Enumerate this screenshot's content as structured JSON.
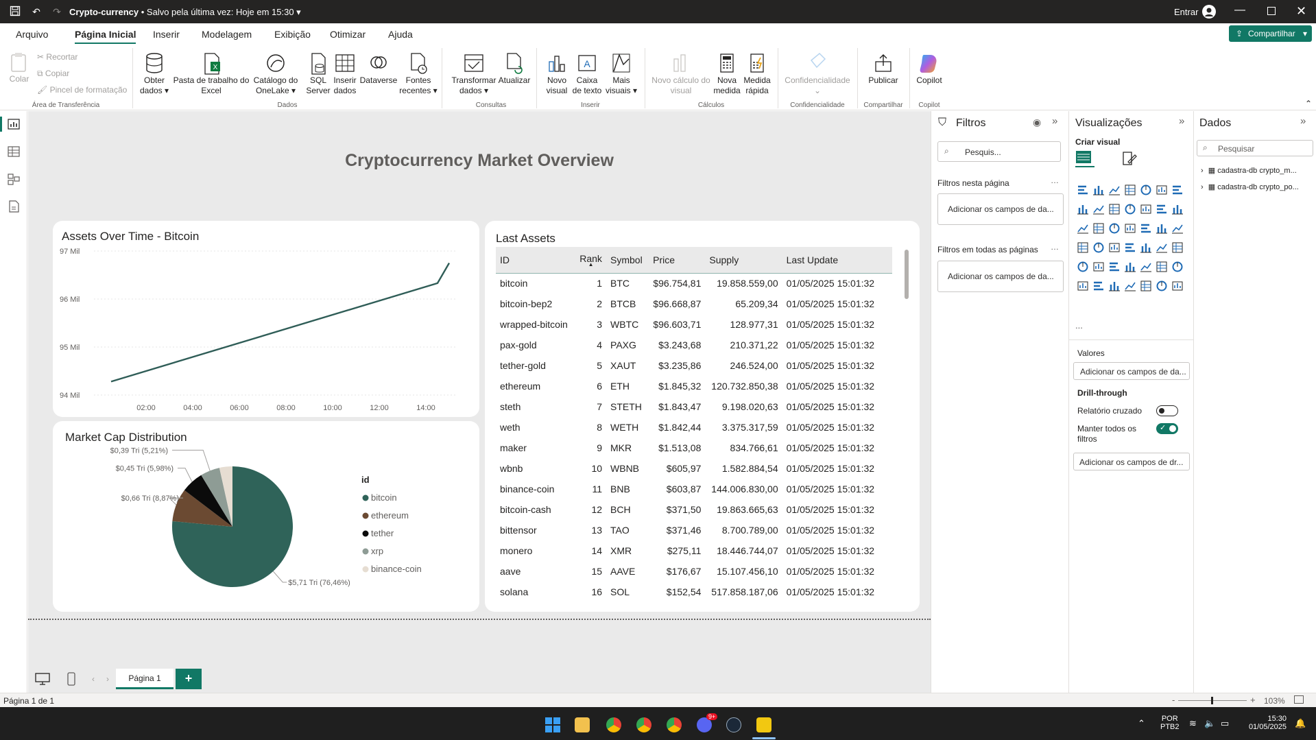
{
  "window": {
    "file_name": "Crypto-currency",
    "saved_status": "• Salvo pela última vez: Hoje em 15:30",
    "signin_label": "Entrar"
  },
  "menu": {
    "items": [
      "Arquivo",
      "Página Inicial",
      "Inserir",
      "Modelagem",
      "Exibição",
      "Otimizar",
      "Ajuda"
    ],
    "active": "Página Inicial",
    "share_label": "Compartilhar"
  },
  "ribbon": {
    "clipboard": {
      "paste": "Colar",
      "cut": "Recortar",
      "copy": "Copiar",
      "format_painter": "Pincel de formatação",
      "group": "Área de Transferência"
    },
    "data": {
      "get_data": "Obter dados",
      "excel": "Pasta de trabalho do Excel",
      "onelake": "Catálogo do OneLake",
      "sql": "SQL Server",
      "enter_data": "Inserir dados",
      "dataverse": "Dataverse",
      "recent": "Fontes recentes",
      "group": "Dados"
    },
    "queries": {
      "transform": "Transformar dados",
      "refresh": "Atualizar",
      "group": "Consultas"
    },
    "insert": {
      "new_visual": "Novo visual",
      "text_box": "Caixa de texto",
      "more_visuals": "Mais visuais",
      "group": "Inserir"
    },
    "calculations": {
      "visual_calc": "Novo cálculo do visual",
      "new_measure": "Nova medida",
      "quick_measure": "Medida rápida",
      "group": "Cálculos"
    },
    "sensitivity": {
      "label": "Confidencialidade",
      "group": "Confidencialidade"
    },
    "share": {
      "publish": "Publicar",
      "group": "Compartilhar"
    },
    "copilot": {
      "label": "Copilot",
      "group": "Copilot"
    }
  },
  "report": {
    "title": "Cryptocurrency Market Overview",
    "line_visual_title": "Assets Over Time - Bitcoin",
    "pie_visual_title": "Market Cap Distribution",
    "pie_legend_title": "id",
    "table_title": "Last Assets",
    "table": {
      "columns": [
        "ID",
        "Rank",
        "Symbol",
        "Price",
        "Supply",
        "Last Update"
      ],
      "rows": [
        [
          "bitcoin",
          "1",
          "BTC",
          "$96.754,81",
          "19.858.559,00",
          "01/05/2025 15:01:32"
        ],
        [
          "bitcoin-bep2",
          "2",
          "BTCB",
          "$96.668,87",
          "65.209,34",
          "01/05/2025 15:01:32"
        ],
        [
          "wrapped-bitcoin",
          "3",
          "WBTC",
          "$96.603,71",
          "128.977,31",
          "01/05/2025 15:01:32"
        ],
        [
          "pax-gold",
          "4",
          "PAXG",
          "$3.243,68",
          "210.371,22",
          "01/05/2025 15:01:32"
        ],
        [
          "tether-gold",
          "5",
          "XAUT",
          "$3.235,86",
          "246.524,00",
          "01/05/2025 15:01:32"
        ],
        [
          "ethereum",
          "6",
          "ETH",
          "$1.845,32",
          "120.732.850,38",
          "01/05/2025 15:01:32"
        ],
        [
          "steth",
          "7",
          "STETH",
          "$1.843,47",
          "9.198.020,63",
          "01/05/2025 15:01:32"
        ],
        [
          "weth",
          "8",
          "WETH",
          "$1.842,44",
          "3.375.317,59",
          "01/05/2025 15:01:32"
        ],
        [
          "maker",
          "9",
          "MKR",
          "$1.513,08",
          "834.766,61",
          "01/05/2025 15:01:32"
        ],
        [
          "wbnb",
          "10",
          "WBNB",
          "$605,97",
          "1.582.884,54",
          "01/05/2025 15:01:32"
        ],
        [
          "binance-coin",
          "11",
          "BNB",
          "$603,87",
          "144.006.830,00",
          "01/05/2025 15:01:32"
        ],
        [
          "bitcoin-cash",
          "12",
          "BCH",
          "$371,50",
          "19.863.665,63",
          "01/05/2025 15:01:32"
        ],
        [
          "bittensor",
          "13",
          "TAO",
          "$371,46",
          "8.700.789,00",
          "01/05/2025 15:01:32"
        ],
        [
          "monero",
          "14",
          "XMR",
          "$275,11",
          "18.446.744,07",
          "01/05/2025 15:01:32"
        ],
        [
          "aave",
          "15",
          "AAVE",
          "$176,67",
          "15.107.456,10",
          "01/05/2025 15:01:32"
        ],
        [
          "solana",
          "16",
          "SOL",
          "$152,54",
          "517.858.187,06",
          "01/05/2025 15:01:32"
        ]
      ]
    }
  },
  "chart_data": [
    {
      "type": "line",
      "title": "Assets Over Time - Bitcoin",
      "x": [
        "00:30",
        "14:30",
        "15:00"
      ],
      "x_ticks": [
        "02:00",
        "04:00",
        "06:00",
        "08:00",
        "10:00",
        "12:00",
        "14:00"
      ],
      "y_ticks": [
        "94 Mil",
        "95 Mil",
        "96 Mil",
        "97 Mil"
      ],
      "ylim": [
        94000,
        97000
      ],
      "series": [
        {
          "values": [
            94280,
            96330,
            96750
          ],
          "color": "#2f5d57"
        }
      ]
    },
    {
      "type": "pie",
      "title": "Market Cap Distribution",
      "legend_title": "id",
      "slices": [
        {
          "label": "bitcoin",
          "value": 76.46,
          "data_label": "$5,71 Tri (76,46%)",
          "color": "#2f6359"
        },
        {
          "label": "ethereum",
          "value": 8.87,
          "data_label": "$0,66 Tri (8,87%)",
          "color": "#6b4a32"
        },
        {
          "label": "tether",
          "value": 5.98,
          "data_label": "$0,45 Tri (5,98%)",
          "color": "#0b0b0b"
        },
        {
          "label": "xrp",
          "value": 5.21,
          "data_label": "$0,39 Tri (5,21%)",
          "color": "#8e9c95"
        },
        {
          "label": "binance-coin",
          "value": 3.48,
          "data_label": "",
          "color": "#e6ddd2"
        }
      ],
      "legend_position": "right"
    }
  ],
  "filters": {
    "title": "Filtros",
    "search_placeholder": "Pesquis...",
    "on_page": "Filtros nesta página",
    "on_page_drop": "Adicionar os campos de da...",
    "all_pages": "Filtros em todas as páginas",
    "all_pages_drop": "Adicionar os campos de da..."
  },
  "visualizations": {
    "title": "Visualizações",
    "build_visual": "Criar visual",
    "values_label": "Valores",
    "values_drop": "Adicionar os campos de da...",
    "drill_label": "Drill-through",
    "cross_report": "Relatório cruzado",
    "cross_report_on": false,
    "keep_filters": "Manter todos os filtros",
    "keep_filters_on": true,
    "drill_drop": "Adicionar os campos de dr...",
    "more": "..."
  },
  "data_pane": {
    "title": "Dados",
    "search_placeholder": "Pesquisar",
    "tables": [
      "cadastra-db crypto_m...",
      "cadastra-db crypto_po..."
    ]
  },
  "pages": {
    "tabs": [
      "Página 1"
    ],
    "add": "+"
  },
  "status": {
    "page_info": "Página 1 de 1",
    "zoom": "103%",
    "minus": "-",
    "plus": "+"
  },
  "taskbar": {
    "lang1": "POR",
    "lang2": "PTB2",
    "time": "15:30",
    "date": "01/05/2025",
    "discord_badge": "9+"
  }
}
